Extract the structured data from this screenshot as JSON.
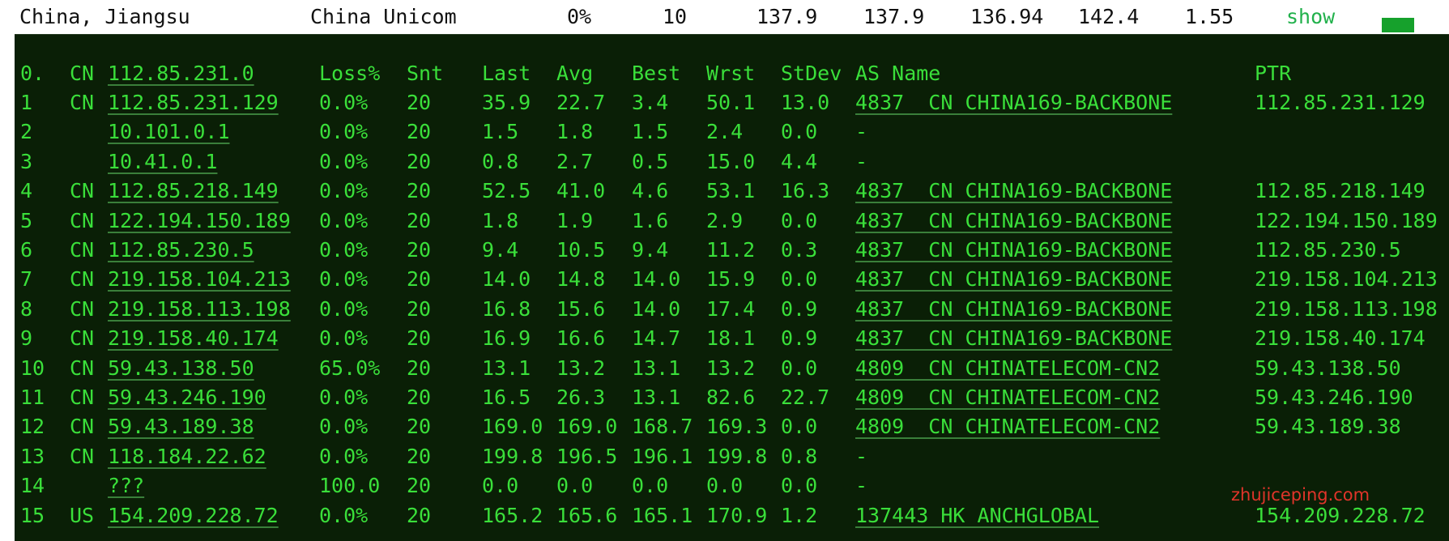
{
  "summary": {
    "location": "China, Jiangsu",
    "isp": "China Unicom",
    "loss": "0%",
    "sent": "10",
    "last": "137.9",
    "avg": "137.9",
    "best": "136.94",
    "worst": "142.4",
    "stdev": "1.55",
    "show_label": "show"
  },
  "colors": {
    "terminal_bg": "#0a1f06",
    "terminal_text": "#3adf3a",
    "show_link": "#22b14c",
    "watermark": "#e0342a"
  },
  "table": {
    "headers": {
      "hop": "0.",
      "cc": "CN",
      "host": "112.85.231.0",
      "loss": "Loss%",
      "snt": "Snt",
      "last": "Last",
      "avg": "Avg",
      "best": "Best",
      "wrst": "Wrst",
      "stdev": "StDev",
      "asname": "AS Name",
      "ptr": "PTR"
    },
    "rows": [
      {
        "hop": "1",
        "cc": "CN",
        "host": "112.85.231.129",
        "loss": "0.0%",
        "snt": "20",
        "last": "35.9",
        "avg": "22.7",
        "best": "3.4",
        "wrst": "50.1",
        "stdev": "13.0",
        "asname": "4837  CN CHINA169-BACKBONE",
        "ptr": "112.85.231.129"
      },
      {
        "hop": "2",
        "cc": "",
        "host": "10.101.0.1",
        "loss": "0.0%",
        "snt": "20",
        "last": "1.5",
        "avg": "1.8",
        "best": "1.5",
        "wrst": "2.4",
        "stdev": "0.0",
        "asname": "-",
        "ptr": ""
      },
      {
        "hop": "3",
        "cc": "",
        "host": "10.41.0.1",
        "loss": "0.0%",
        "snt": "20",
        "last": "0.8",
        "avg": "2.7",
        "best": "0.5",
        "wrst": "15.0",
        "stdev": "4.4",
        "asname": "-",
        "ptr": ""
      },
      {
        "hop": "4",
        "cc": "CN",
        "host": "112.85.218.149",
        "loss": "0.0%",
        "snt": "20",
        "last": "52.5",
        "avg": "41.0",
        "best": "4.6",
        "wrst": "53.1",
        "stdev": "16.3",
        "asname": "4837  CN CHINA169-BACKBONE",
        "ptr": "112.85.218.149"
      },
      {
        "hop": "5",
        "cc": "CN",
        "host": "122.194.150.189",
        "loss": "0.0%",
        "snt": "20",
        "last": "1.8",
        "avg": "1.9",
        "best": "1.6",
        "wrst": "2.9",
        "stdev": "0.0",
        "asname": "4837  CN CHINA169-BACKBONE",
        "ptr": "122.194.150.189"
      },
      {
        "hop": "6",
        "cc": "CN",
        "host": "112.85.230.5",
        "loss": "0.0%",
        "snt": "20",
        "last": "9.4",
        "avg": "10.5",
        "best": "9.4",
        "wrst": "11.2",
        "stdev": "0.3",
        "asname": "4837  CN CHINA169-BACKBONE",
        "ptr": "112.85.230.5"
      },
      {
        "hop": "7",
        "cc": "CN",
        "host": "219.158.104.213",
        "loss": "0.0%",
        "snt": "20",
        "last": "14.0",
        "avg": "14.8",
        "best": "14.0",
        "wrst": "15.9",
        "stdev": "0.0",
        "asname": "4837  CN CHINA169-BACKBONE",
        "ptr": "219.158.104.213"
      },
      {
        "hop": "8",
        "cc": "CN",
        "host": "219.158.113.198",
        "loss": "0.0%",
        "snt": "20",
        "last": "16.8",
        "avg": "15.6",
        "best": "14.0",
        "wrst": "17.4",
        "stdev": "0.9",
        "asname": "4837  CN CHINA169-BACKBONE",
        "ptr": "219.158.113.198"
      },
      {
        "hop": "9",
        "cc": "CN",
        "host": "219.158.40.174",
        "loss": "0.0%",
        "snt": "20",
        "last": "16.9",
        "avg": "16.6",
        "best": "14.7",
        "wrst": "18.1",
        "stdev": "0.9",
        "asname": "4837  CN CHINA169-BACKBONE",
        "ptr": "219.158.40.174"
      },
      {
        "hop": "10",
        "cc": "CN",
        "host": "59.43.138.50",
        "loss": "65.0%",
        "snt": "20",
        "last": "13.1",
        "avg": "13.2",
        "best": "13.1",
        "wrst": "13.2",
        "stdev": "0.0",
        "asname": "4809  CN CHINATELECOM-CN2",
        "ptr": "59.43.138.50"
      },
      {
        "hop": "11",
        "cc": "CN",
        "host": "59.43.246.190",
        "loss": "0.0%",
        "snt": "20",
        "last": "16.5",
        "avg": "26.3",
        "best": "13.1",
        "wrst": "82.6",
        "stdev": "22.7",
        "asname": "4809  CN CHINATELECOM-CN2",
        "ptr": "59.43.246.190"
      },
      {
        "hop": "12",
        "cc": "CN",
        "host": "59.43.189.38",
        "loss": "0.0%",
        "snt": "20",
        "last": "169.0",
        "avg": "169.0",
        "best": "168.7",
        "wrst": "169.3",
        "stdev": "0.0",
        "asname": "4809  CN CHINATELECOM-CN2",
        "ptr": "59.43.189.38"
      },
      {
        "hop": "13",
        "cc": "CN",
        "host": "118.184.22.62",
        "loss": "0.0%",
        "snt": "20",
        "last": "199.8",
        "avg": "196.5",
        "best": "196.1",
        "wrst": "199.8",
        "stdev": "0.8",
        "asname": "-",
        "ptr": ""
      },
      {
        "hop": "14",
        "cc": "",
        "host": "???",
        "loss": "100.0",
        "snt": "20",
        "last": "0.0",
        "avg": "0.0",
        "best": "0.0",
        "wrst": "0.0",
        "stdev": "0.0",
        "asname": "-",
        "ptr": ""
      },
      {
        "hop": "15",
        "cc": "US",
        "host": "154.209.228.72",
        "loss": "0.0%",
        "snt": "20",
        "last": "165.2",
        "avg": "165.6",
        "best": "165.1",
        "wrst": "170.9",
        "stdev": "1.2",
        "asname": "137443 HK ANCHGLOBAL",
        "ptr": "154.209.228.72"
      }
    ]
  },
  "watermark": "zhujiceping.com"
}
